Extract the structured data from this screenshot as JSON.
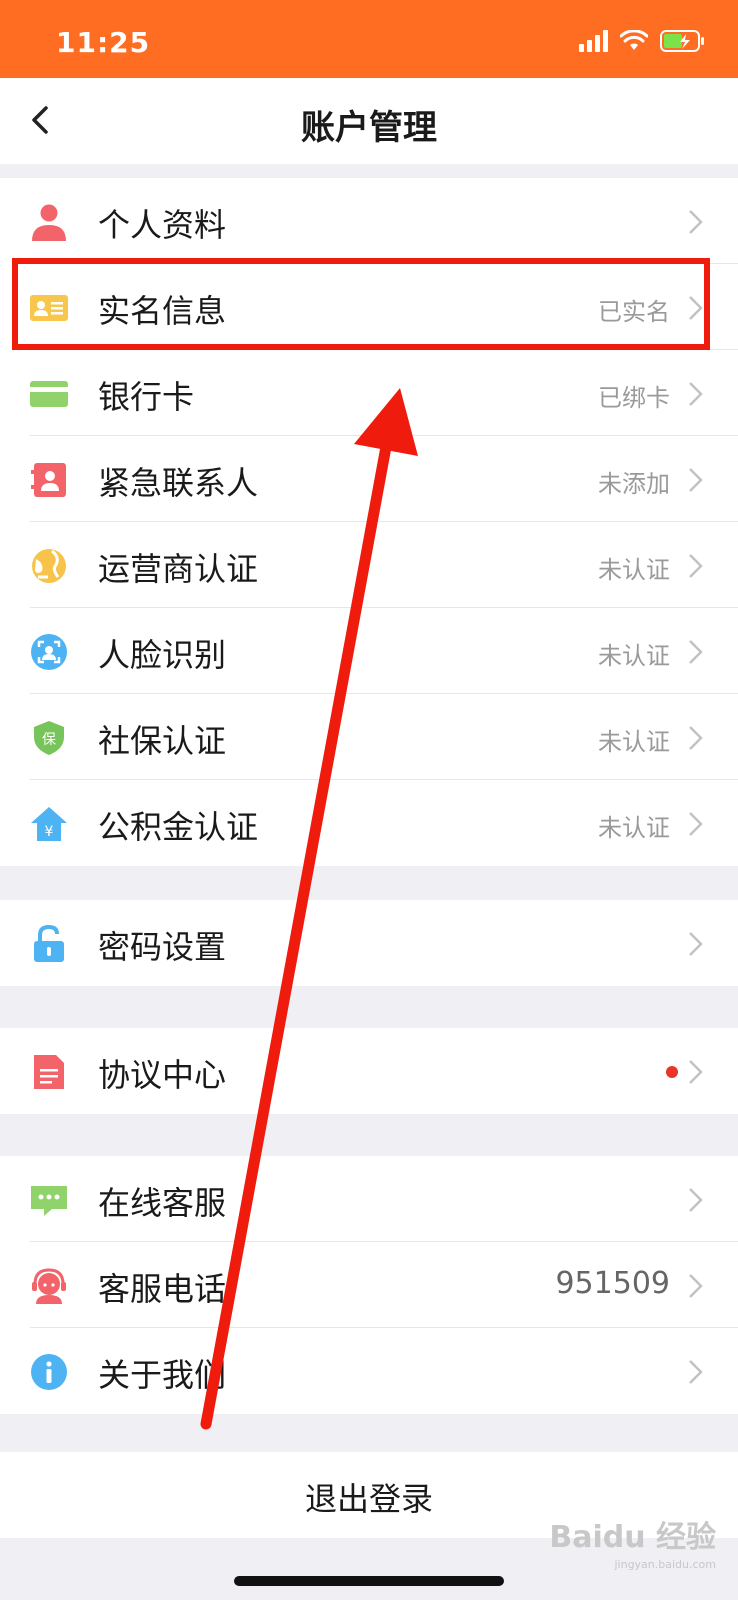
{
  "status_bar": {
    "time": "11:25"
  },
  "nav": {
    "title": "账户管理"
  },
  "groups": [
    {
      "items": [
        {
          "label": "个人资料",
          "value": "",
          "icon": "person-icon"
        },
        {
          "label": "实名信息",
          "value": "已实名",
          "icon": "id-card-icon"
        },
        {
          "label": "银行卡",
          "value": "已绑卡",
          "icon": "bank-card-icon"
        },
        {
          "label": "紧急联系人",
          "value": "未添加",
          "icon": "contact-book-icon"
        },
        {
          "label": "运营商认证",
          "value": "未认证",
          "icon": "globe-icon"
        },
        {
          "label": "人脸识别",
          "value": "未认证",
          "icon": "face-scan-icon"
        },
        {
          "label": "社保认证",
          "value": "未认证",
          "icon": "shield-icon"
        },
        {
          "label": "公积金认证",
          "value": "未认证",
          "icon": "house-yuan-icon"
        }
      ]
    },
    {
      "items": [
        {
          "label": "密码设置",
          "value": "",
          "icon": "lock-icon"
        }
      ]
    },
    {
      "items": [
        {
          "label": "协议中心",
          "value": "",
          "icon": "document-icon",
          "dot": true
        }
      ]
    },
    {
      "items": [
        {
          "label": "在线客服",
          "value": "",
          "icon": "chat-icon"
        },
        {
          "label": "客服电话",
          "value": "951509",
          "icon": "headset-icon"
        },
        {
          "label": "关于我们",
          "value": "",
          "icon": "info-icon"
        }
      ]
    }
  ],
  "logout": {
    "label": "退出登录"
  },
  "watermark": {
    "text": "Baidu 经验",
    "sub": "jingyan.baidu.com"
  },
  "colors": {
    "status_bar": "#ff6d22",
    "highlight": "#ef1c0e",
    "arrow": "#ef1c0e"
  }
}
